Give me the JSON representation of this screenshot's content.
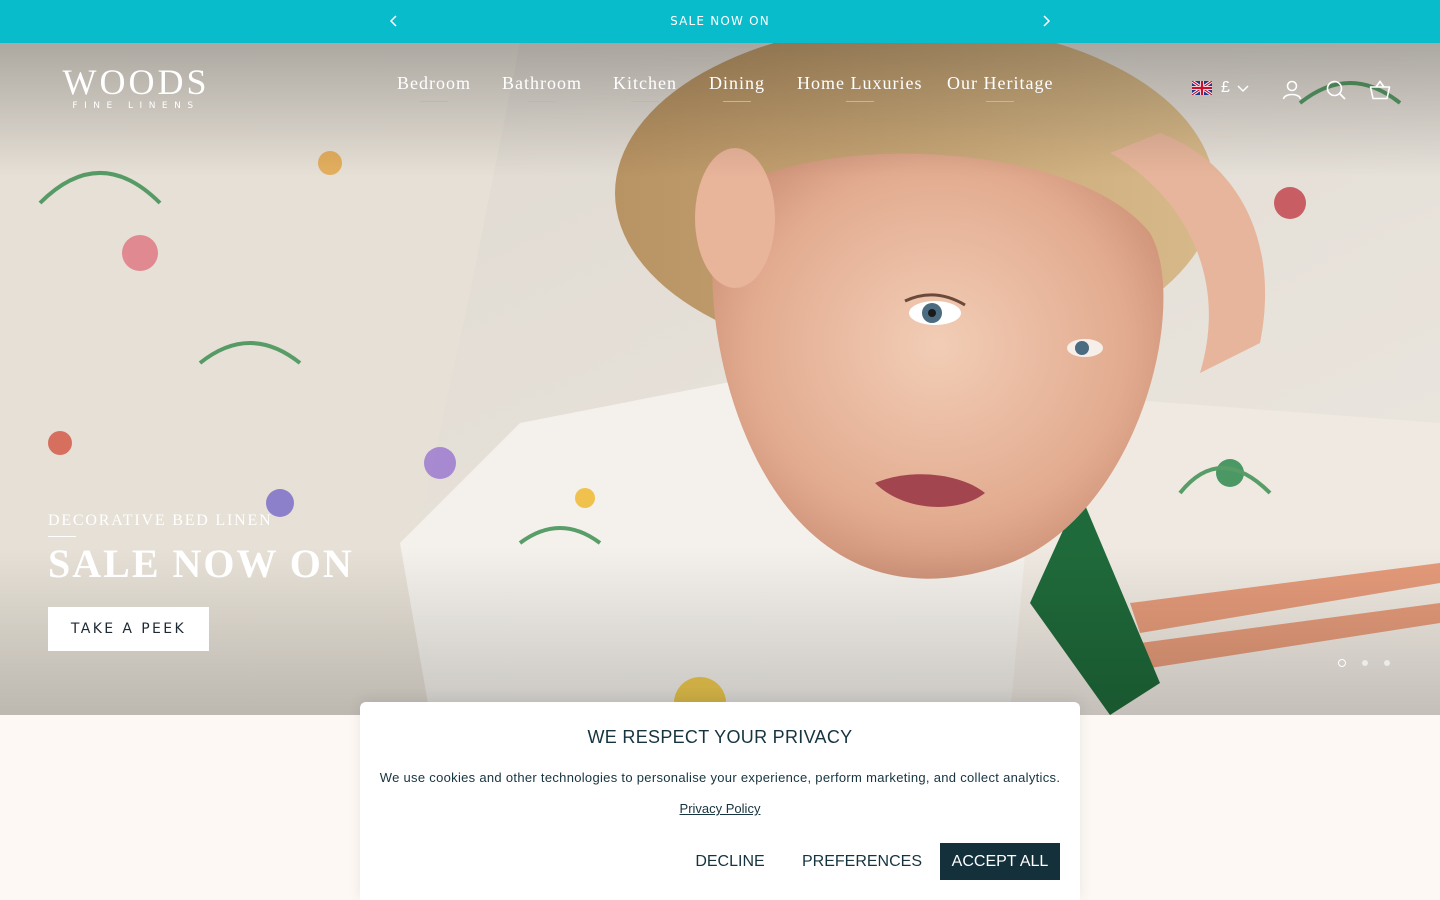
{
  "announcement": {
    "text": "SALE NOW ON",
    "background": "#08bccc"
  },
  "header": {
    "logo_main": "WOODS",
    "logo_sub": "FINE LINENS",
    "nav": [
      "Bedroom",
      "Bathroom",
      "Kitchen",
      "Dining",
      "Home Luxuries",
      "Our Heritage"
    ],
    "currency": "£",
    "icons": [
      "uk-flag-icon",
      "chevron-down-icon",
      "account-icon",
      "search-icon",
      "basket-icon"
    ]
  },
  "hero": {
    "subtitle": "DECORATIVE BED LINEN",
    "title": "SALE NOW ON",
    "cta": "TAKE A PEEK",
    "slides_total": 3,
    "active_slide": 1
  },
  "cookie_banner": {
    "title": "WE RESPECT YOUR PRIVACY",
    "message": "We use cookies and other technologies to personalise your experience, perform marketing, and collect analytics.",
    "policy_link": "Privacy Policy",
    "decline": "DECLINE",
    "preferences": "PREFERENCES",
    "accept": "ACCEPT ALL",
    "accent": "#13303b"
  }
}
